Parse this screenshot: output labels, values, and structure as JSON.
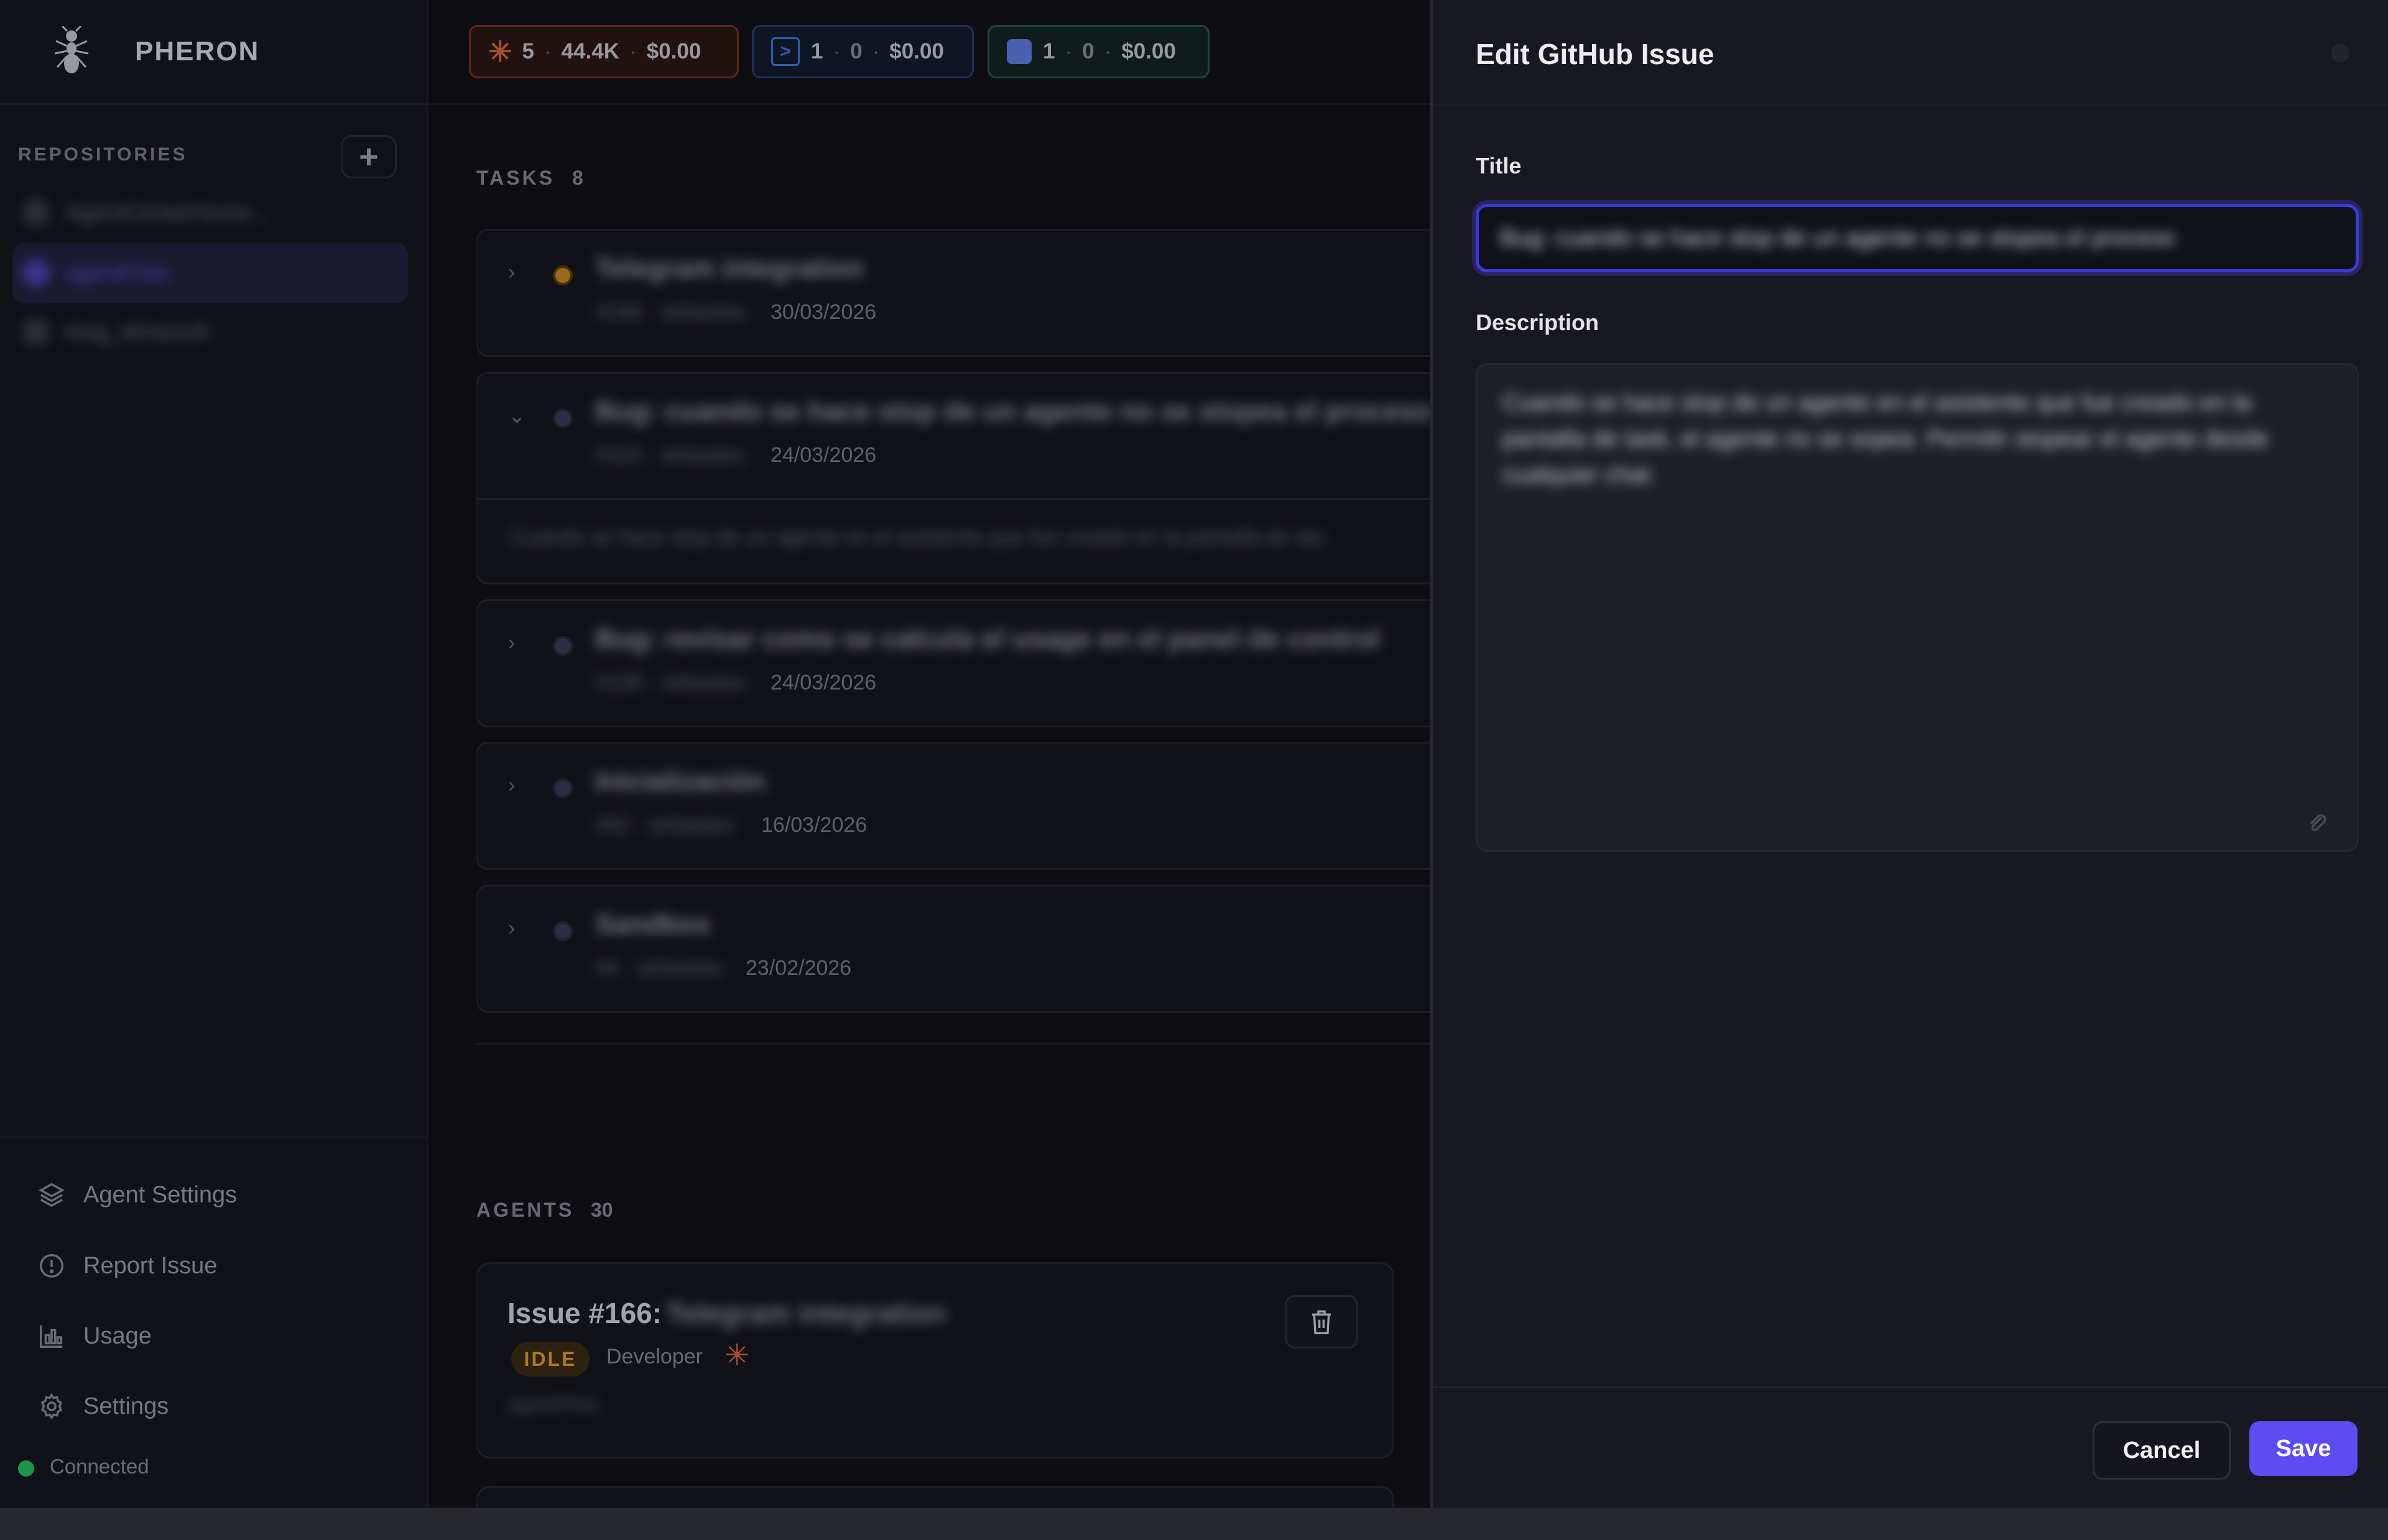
{
  "app": {
    "name": "PHERON"
  },
  "sidebar": {
    "repositories_label": "REPOSITORIES",
    "repos": [
      {
        "name": "AgentCenterHome..."
      },
      {
        "name": "agentFlow",
        "active": true
      },
      {
        "name": "blog_Writesoft"
      }
    ],
    "nav": [
      {
        "label": "Agent Settings",
        "icon": "layers-icon"
      },
      {
        "label": "Report Issue",
        "icon": "alert-circle-icon"
      },
      {
        "label": "Usage",
        "icon": "bar-chart-icon"
      },
      {
        "label": "Settings",
        "icon": "gear-icon"
      }
    ],
    "status": {
      "label": "Connected",
      "color": "#22c55e"
    }
  },
  "stats": [
    {
      "icon": "claude-icon",
      "count": "5",
      "tokens": "44.4K",
      "cost": "$0.00",
      "border": "#7a3322",
      "bg": "#2a1612"
    },
    {
      "icon": "terminal-icon",
      "count": "1",
      "tokens": "0",
      "cost": "$0.00",
      "border": "#27426e",
      "bg": "#121b2b"
    },
    {
      "icon": "gemini-icon",
      "count": "1",
      "tokens": "0",
      "cost": "$0.00",
      "border": "#235a4f",
      "bg": "#112420"
    }
  ],
  "tasks": {
    "label": "TASKS",
    "count": "8",
    "items": [
      {
        "title": "Telegram integration",
        "number": "#166",
        "author": "sirbastes",
        "date": "30/03/2026",
        "status_color": "#d08a1a"
      },
      {
        "title": "Bug: cuando se hace stop de un agente no se stopea el proceso",
        "number": "#113",
        "author": "sirbastes",
        "date": "24/03/2026",
        "status_color": "#5a5a7a",
        "expanded": true,
        "body": "Cuando se hace stop de un agente en el asistente que fue creado en la pantalla de tas"
      },
      {
        "title": "Bug: revisar como se calcula el usage en el panel de control",
        "number": "#109",
        "author": "sirbastes",
        "date": "24/03/2026",
        "status_color": "#4a4a60"
      },
      {
        "title": "Inicialización",
        "number": "#62",
        "author": "sirbastes",
        "date": "16/03/2026",
        "status_color": "#4a4a60"
      },
      {
        "title": "Sandbox",
        "number": "#4",
        "author": "sirbastes",
        "date": "23/02/2026",
        "status_color": "#4a4a60"
      }
    ]
  },
  "agents": {
    "label": "AGENTS",
    "count": "30",
    "card": {
      "title_prefix": "Issue #166:",
      "title_rest": "Telegram integration",
      "status": "IDLE",
      "role": "Developer",
      "repo": "agentFlow"
    }
  },
  "modal": {
    "title": "Edit GitHub Issue",
    "title_label": "Title",
    "title_value": "Bug: cuando se hace stop de un agente no se stopea el proceso",
    "description_label": "Description",
    "description_value": "Cuando se hace stop de un agente en el asistente que fue creado en la pantalla de task, el agente no se sopea. Permitir stopear el agente desde cualquier chat.",
    "cancel_label": "Cancel",
    "save_label": "Save",
    "accent": "#5b4df2"
  }
}
